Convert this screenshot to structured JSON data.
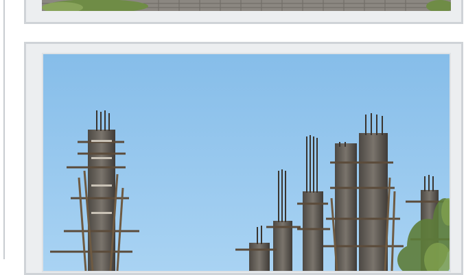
{
  "feed": {
    "cards": [
      {
        "type": "image",
        "icon": "photo-wall-partial"
      },
      {
        "type": "image",
        "icon": "photo-construction-pillars"
      }
    ]
  },
  "colors": {
    "card_bg": "#eceef0",
    "card_border": "#cfd3d7",
    "sky": "#8fc4ee",
    "concrete": "#6b6660",
    "foliage": "#5e7d3a"
  }
}
